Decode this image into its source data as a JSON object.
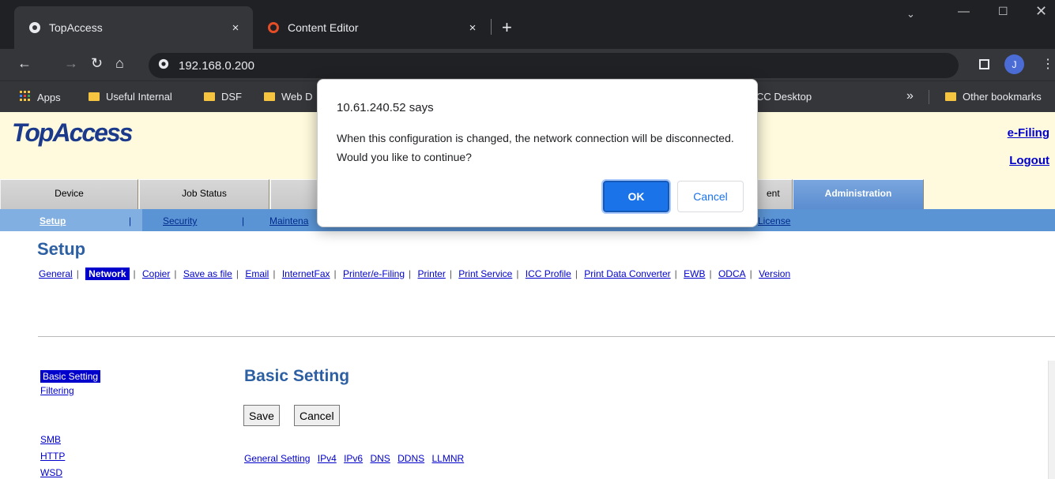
{
  "browser": {
    "tabs": [
      {
        "title": "TopAccess",
        "close": "×"
      },
      {
        "title": "Content Editor",
        "close": "×"
      }
    ],
    "new_tab": "+",
    "url": "192.168.0.200",
    "profile_initial": "J",
    "bookmarks": [
      "Apps",
      "Useful Internal",
      "DSF",
      "Web D",
      "CC Desktop",
      "Other bookmarks"
    ],
    "overflow": "»"
  },
  "page": {
    "logo": "TopAccess",
    "header_links": [
      "e-Filing",
      "Logout"
    ],
    "tabs": [
      "Device",
      "Job Status",
      "ent",
      "Administration"
    ],
    "subnav": [
      "Setup",
      "Security",
      "Maintena",
      "License"
    ],
    "setup_title": "Setup",
    "setup_nav": [
      "General",
      "Network",
      "Copier",
      "Save as file",
      "Email",
      "InternetFax",
      "Printer/e-Filing",
      "Printer",
      "Print Service",
      "ICC Profile",
      "Print Data Converter",
      "EWB",
      "ODCA",
      "Version"
    ],
    "side_nav": [
      "Basic Setting",
      "Filtering",
      "SMB",
      "HTTP",
      "WSD"
    ],
    "section_title": "Basic Setting",
    "buttons": {
      "save": "Save",
      "cancel": "Cancel"
    },
    "section_nav": [
      "General Setting",
      "IPv4",
      "IPv6",
      "DNS",
      "DDNS",
      "LLMNR"
    ]
  },
  "dialog": {
    "title": "10.61.240.52 says",
    "message": "When this configuration is changed, the network connection will be disconnected.  Would you like to continue?",
    "ok": "OK",
    "cancel": "Cancel"
  },
  "colors": {
    "accent": "#1a73e8",
    "header_bg": "#fffadd",
    "subnav_bg": "#5b94d4",
    "title": "#2d5fa3"
  }
}
